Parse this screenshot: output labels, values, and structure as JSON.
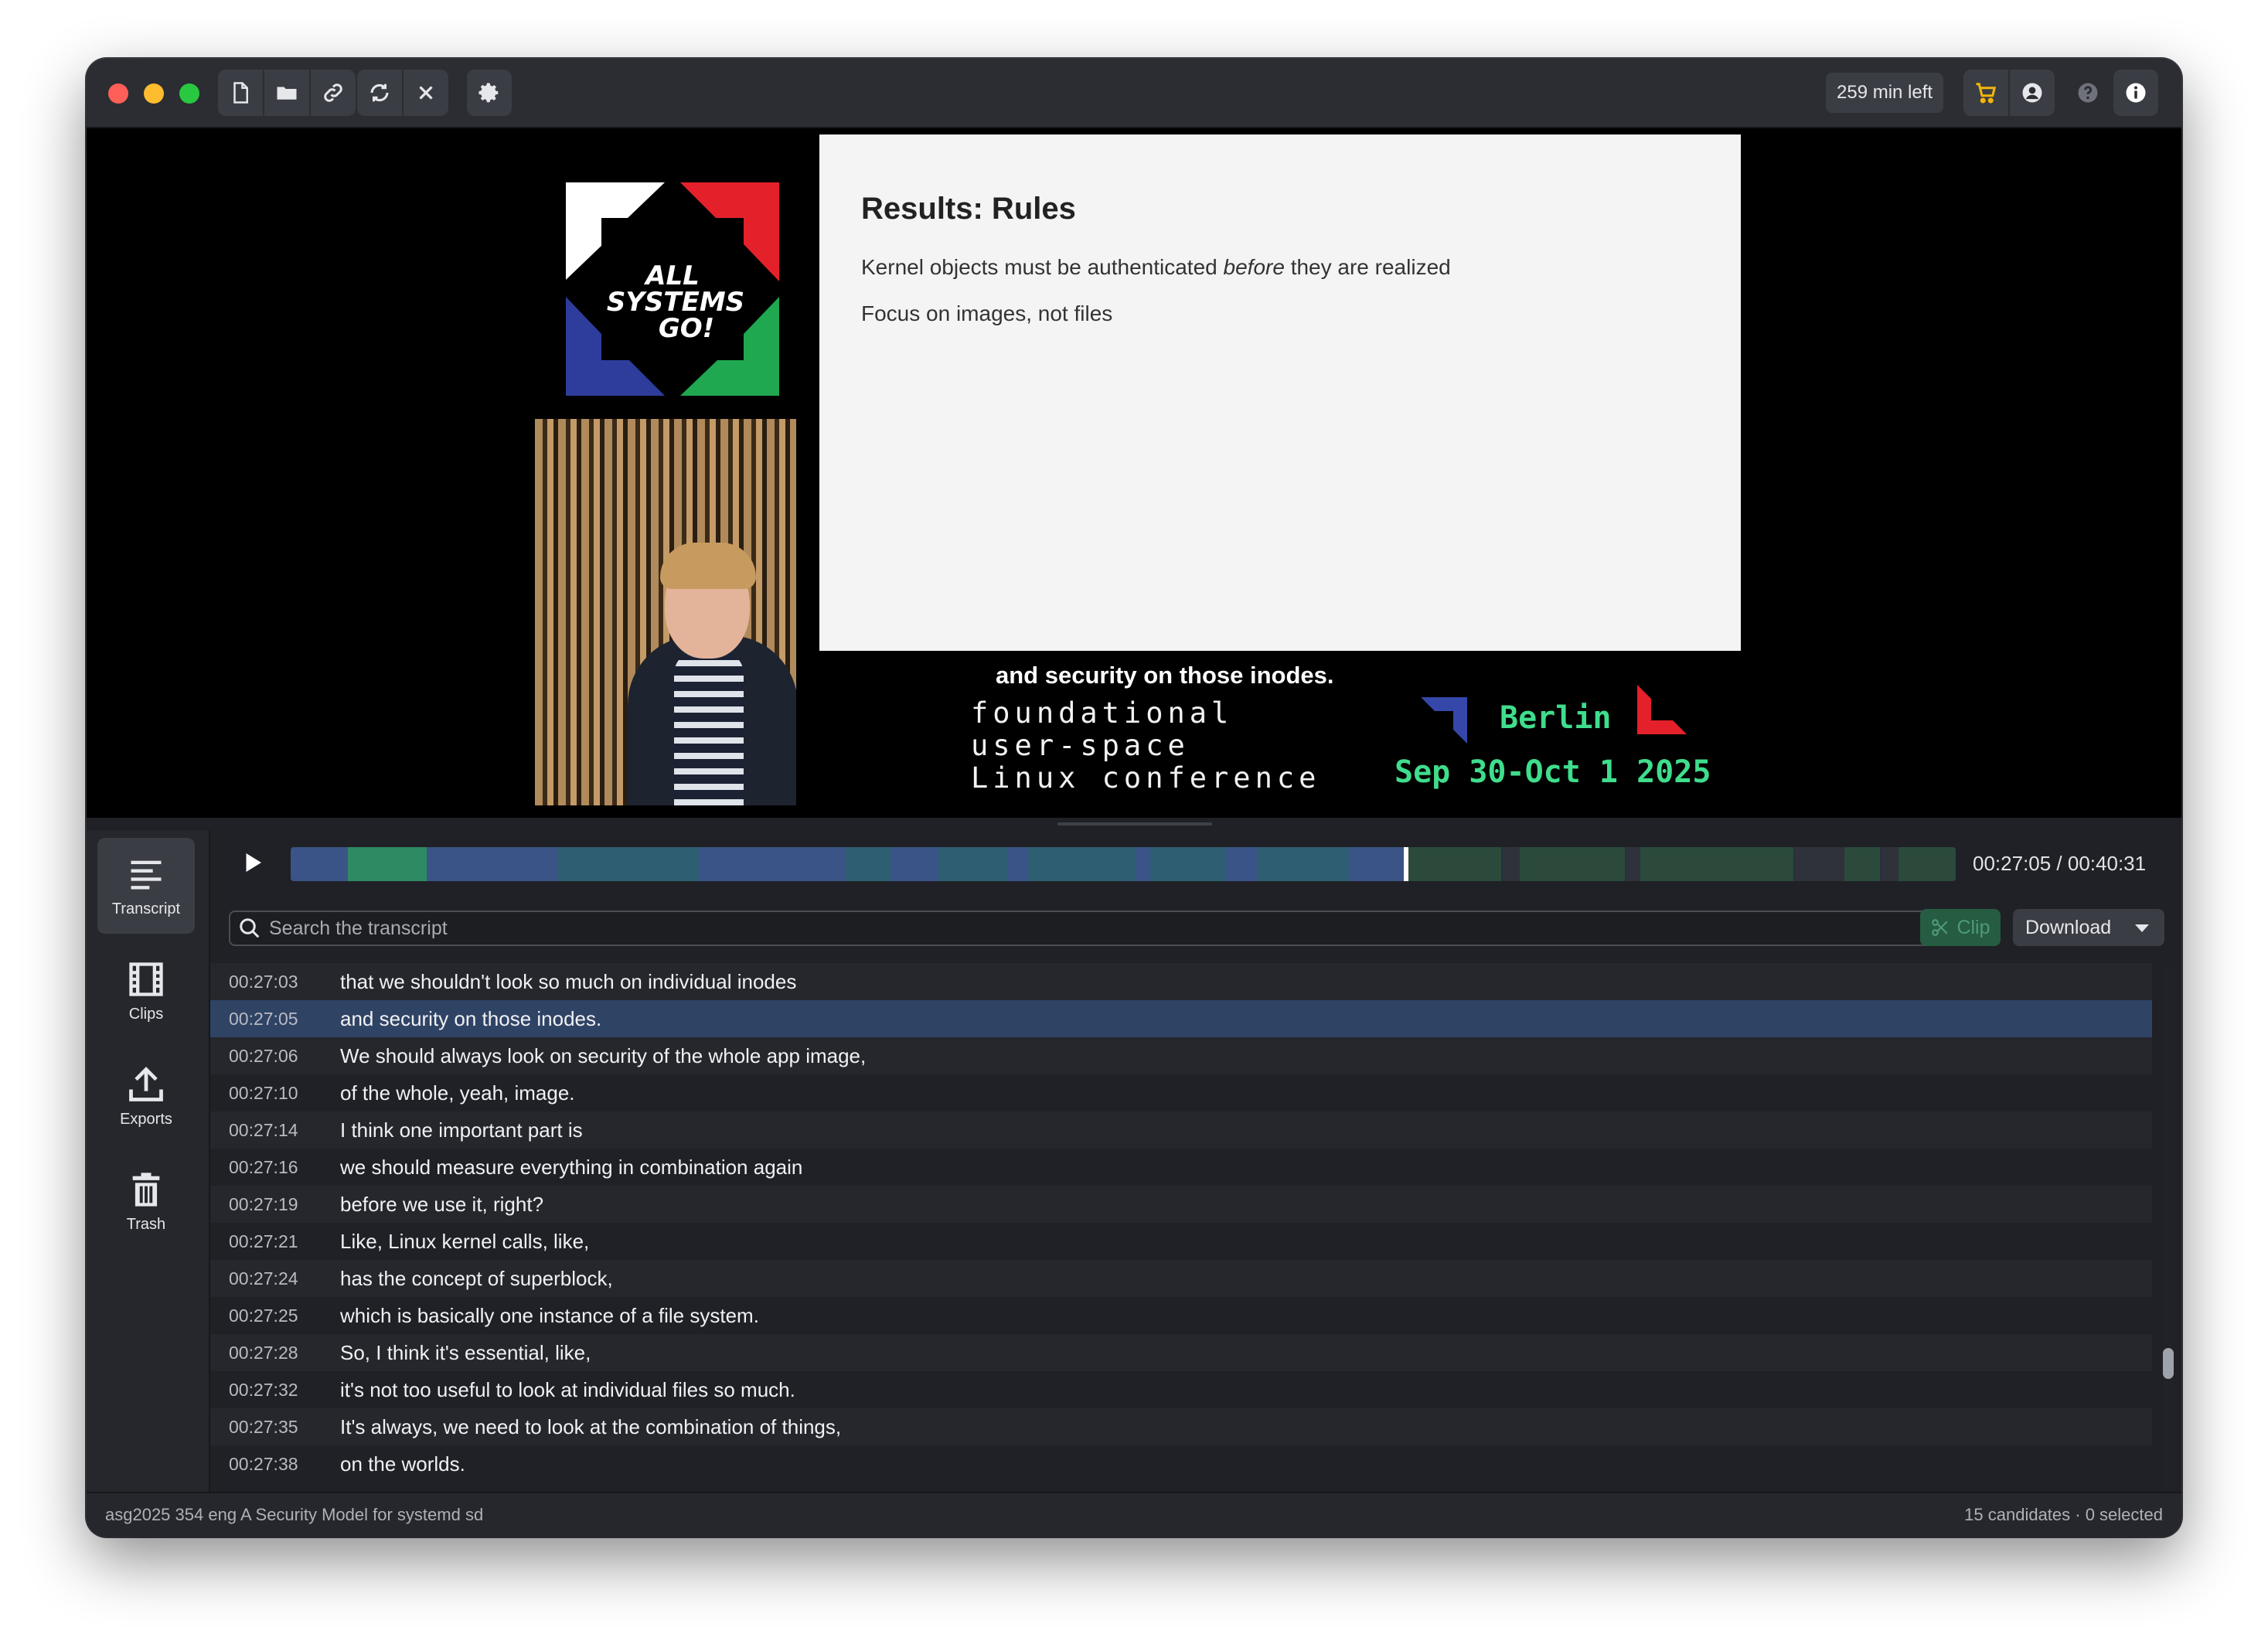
{
  "toolbar": {
    "minutes_left": "259 min left"
  },
  "video": {
    "logo_text": [
      "ALL",
      "SYSTEMS",
      "GO!"
    ],
    "slide": {
      "title": "Results: Rules",
      "line1_before": "Kernel objects must be authenticated ",
      "line1_emph": "before",
      "line1_after": " they are realized",
      "line2": "Focus on images, not files"
    },
    "caption": "and security on those inodes.",
    "conference_lines": [
      "foundational",
      "user-space",
      "Linux conference"
    ],
    "city": "Berlin",
    "dates": "Sep 30-Oct 1 2025"
  },
  "sidebar": {
    "items": [
      {
        "label": "Transcript",
        "icon": "transcript-icon"
      },
      {
        "label": "Clips",
        "icon": "film-icon"
      },
      {
        "label": "Exports",
        "icon": "upload-icon"
      },
      {
        "label": "Trash",
        "icon": "trash-icon"
      }
    ]
  },
  "player": {
    "time": "00:27:05 / 00:40:31",
    "colors": {
      "blue": "#3b5487",
      "teal": "#2e5e72",
      "green": "#2e8a63",
      "dim_green": "#2b4a3b",
      "dim": "#2f323a"
    }
  },
  "search": {
    "placeholder": "Search the transcript"
  },
  "actions": {
    "clip_label": "Clip",
    "download_label": "Download"
  },
  "transcript": [
    {
      "time": "00:27:03",
      "text": "that we shouldn't look so much on individual inodes"
    },
    {
      "time": "00:27:05",
      "text": "and security on those inodes.",
      "active": true
    },
    {
      "time": "00:27:06",
      "text": "We should always look on security of the whole app image,"
    },
    {
      "time": "00:27:10",
      "text": "of the whole, yeah, image."
    },
    {
      "time": "00:27:14",
      "text": "I think one important part is"
    },
    {
      "time": "00:27:16",
      "text": "we should measure everything in combination again"
    },
    {
      "time": "00:27:19",
      "text": "before we use it, right?"
    },
    {
      "time": "00:27:21",
      "text": "Like, Linux kernel calls, like,"
    },
    {
      "time": "00:27:24",
      "text": "has the concept of superblock,"
    },
    {
      "time": "00:27:25",
      "text": "which is basically one instance of a file system."
    },
    {
      "time": "00:27:28",
      "text": "So, I think it's essential, like,"
    },
    {
      "time": "00:27:32",
      "text": "it's not too useful to look at individual files so much."
    },
    {
      "time": "00:27:35",
      "text": "It's always, we need to look at the combination of things,"
    },
    {
      "time": "00:27:38",
      "text": "on the worlds."
    }
  ],
  "status": {
    "filename": "asg2025 354 eng A Security Model for systemd sd",
    "selection": "15 candidates · 0 selected"
  }
}
